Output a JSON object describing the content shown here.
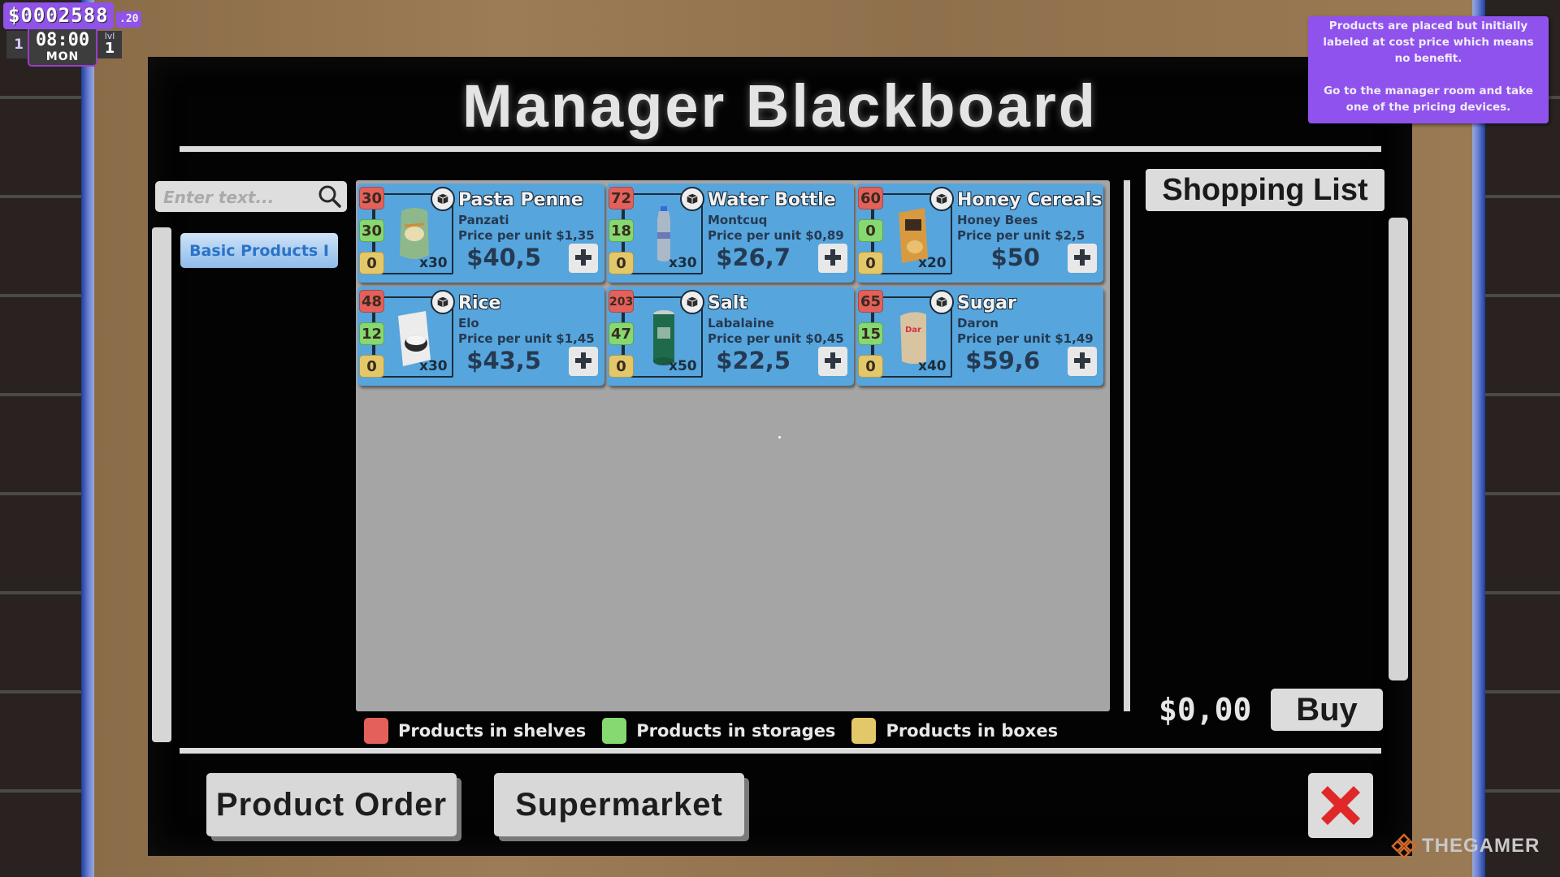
{
  "hud": {
    "money": "$0002588",
    "cents": ".20",
    "day_number": "1",
    "time": "08:00",
    "weekday": "MON",
    "level_label": "lvl",
    "level_value": "1"
  },
  "tip": {
    "text": "Products are placed but initially labeled at cost price which means no benefit.\n\nGo to the manager room and take one of the pricing devices."
  },
  "title": "Manager Blackboard",
  "search": {
    "placeholder": "Enter text...",
    "value": "",
    "icon": "search-icon"
  },
  "categories": [
    {
      "label": "Basic Products I",
      "selected": true
    }
  ],
  "products": [
    {
      "name": "Pasta Penne",
      "brand": "Panzati",
      "price_per_unit": "Price per unit $1,35",
      "box_qty": "x30",
      "total": "$40,5",
      "in_shelves": "30",
      "in_storages": "30",
      "in_boxes": "0",
      "image": "pasta-bag"
    },
    {
      "name": "Water Bottle",
      "brand": "Montcuq",
      "price_per_unit": "Price per unit $0,89",
      "box_qty": "x30",
      "total": "$26,7",
      "in_shelves": "72",
      "in_storages": "18",
      "in_boxes": "0",
      "image": "water-bottle"
    },
    {
      "name": "Honey Cereals",
      "brand": "Honey Bees",
      "price_per_unit": "Price per unit $2,5",
      "box_qty": "x20",
      "total": "$50",
      "in_shelves": "60",
      "in_storages": "0",
      "in_boxes": "0",
      "image": "cereal-box"
    },
    {
      "name": "Rice",
      "brand": "Elo",
      "price_per_unit": "Price per unit $1,45",
      "box_qty": "x30",
      "total": "$43,5",
      "in_shelves": "48",
      "in_storages": "12",
      "in_boxes": "0",
      "image": "rice-box"
    },
    {
      "name": "Salt",
      "brand": "Labalaine",
      "price_per_unit": "Price per unit $0,45",
      "box_qty": "x50",
      "total": "$22,5",
      "in_shelves": "203",
      "in_storages": "47",
      "in_boxes": "0",
      "image": "salt-canister"
    },
    {
      "name": "Sugar",
      "brand": "Daron",
      "price_per_unit": "Price per unit $1,49",
      "box_qty": "x40",
      "total": "$59,6",
      "in_shelves": "65",
      "in_storages": "15",
      "in_boxes": "0",
      "image": "sugar-bag"
    }
  ],
  "legend": [
    {
      "label": "Products in shelves",
      "color": "#e4605a"
    },
    {
      "label": "Products in storages",
      "color": "#86d870"
    },
    {
      "label": "Products in boxes",
      "color": "#e3c86a"
    }
  ],
  "shopping_list": {
    "title": "Shopping List",
    "items": [],
    "total": "$0,00",
    "buy_label": "Buy"
  },
  "bottom_buttons": {
    "product_order": "Product Order",
    "supermarket": "Supermarket"
  },
  "watermark": "THEGAMER",
  "colors": {
    "hud_purple": "#8f53e8",
    "card_blue": "#57a5dd",
    "close_red": "#e02828"
  }
}
